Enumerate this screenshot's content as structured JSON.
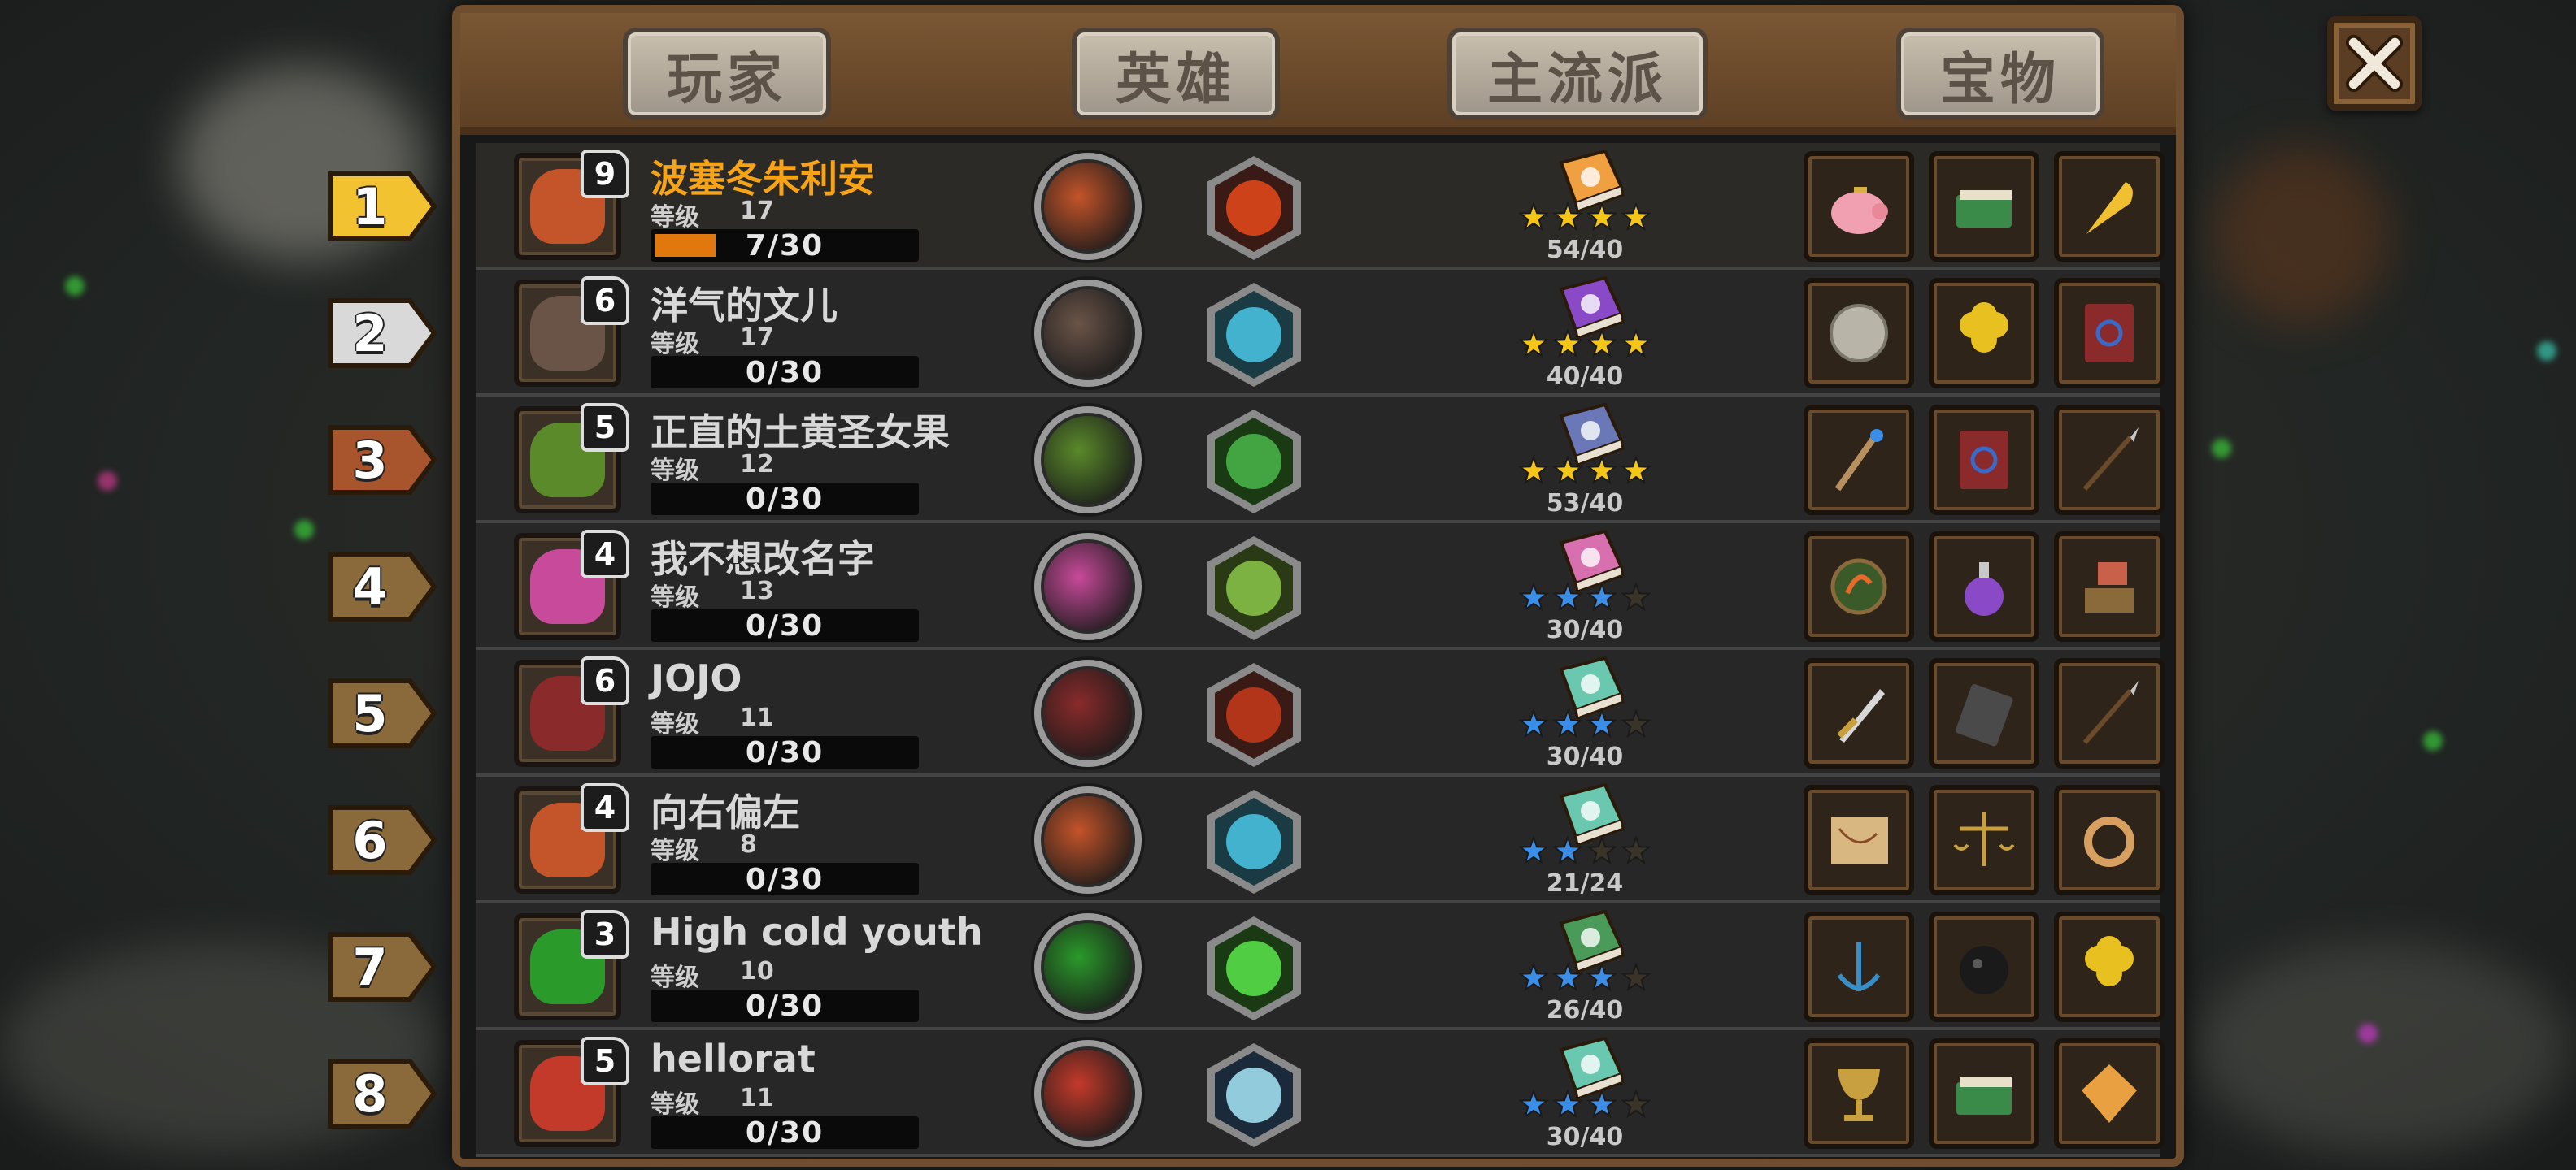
{
  "tabs": {
    "players": "玩家",
    "heroes": "英雄",
    "main_school": "主流派",
    "treasures": "宝物"
  },
  "level_label": "等级",
  "players": [
    {
      "rank": "1",
      "name": "波塞冬朱利安",
      "level": "17",
      "badge": "9",
      "xp": "7/30",
      "xp_fraction": 0.233,
      "book_count": "54/40",
      "stars": 4,
      "name_color": "#f7a318",
      "rank_color": "#f2c230",
      "hero_color": "#c4542a",
      "skill": "fire",
      "book_color": "#f0a040",
      "book_icon": "heart-icon",
      "star_color": "#f5c518",
      "treasures": [
        "piggy-bank-icon",
        "green-book-icon",
        "golden-feather-icon"
      ]
    },
    {
      "rank": "2",
      "name": "洋气的文儿",
      "level": "17",
      "badge": "6",
      "xp": "0/30",
      "xp_fraction": 0,
      "book_count": "40/40",
      "stars": 4,
      "name_color": "#d8d8d8",
      "rank_color": "#d9d9d9",
      "hero_color": "#6a5448",
      "skill": "ice",
      "book_color": "#8a4ac8",
      "book_icon": "skull-icon",
      "star_color": "#f5c518",
      "treasures": [
        "compass-coin-icon",
        "clover-icon",
        "red-spellbook-icon"
      ]
    },
    {
      "rank": "3",
      "name": "正直的土黄圣女果",
      "level": "12",
      "badge": "5",
      "xp": "0/30",
      "xp_fraction": 0,
      "book_count": "53/40",
      "stars": 4,
      "name_color": "#d8d8d8",
      "rank_color": "#a8552e",
      "hero_color": "#5a8a2a",
      "skill": "vine",
      "book_color": "#6a78b8",
      "book_icon": "sword-icon",
      "star_color": "#f5c518",
      "treasures": [
        "staff-icon",
        "red-spellbook-icon",
        "spear-icon"
      ]
    },
    {
      "rank": "4",
      "name": "我不想改名字",
      "level": "13",
      "badge": "4",
      "xp": "0/30",
      "xp_fraction": 0,
      "book_count": "30/40",
      "stars": 3,
      "name_color": "#d8d8d8",
      "rank_color": "#8a6a3a",
      "hero_color": "#c84a9a",
      "skill": "roots",
      "book_color": "#d870b0",
      "book_icon": "swirl-icon",
      "star_color": "#3a8ee8",
      "treasures": [
        "seed-medallion-icon",
        "potion-icon",
        "anvil-icon"
      ]
    },
    {
      "rank": "5",
      "name": "JOJO",
      "level": "11",
      "badge": "6",
      "xp": "0/30",
      "xp_fraction": 0,
      "book_count": "30/40",
      "stars": 3,
      "name_color": "#d8d8d8",
      "rank_color": "#8a6a3a",
      "hero_color": "#8a2a2a",
      "skill": "bomb",
      "book_color": "#6ac8b0",
      "book_icon": "sun-icon",
      "star_color": "#3a8ee8",
      "treasures": [
        "dagger-icon",
        "rune-tablet-icon",
        "spear-icon"
      ]
    },
    {
      "rank": "6",
      "name": "向右偏左",
      "level": "8",
      "badge": "4",
      "xp": "0/30",
      "xp_fraction": 0,
      "book_count": "21/24",
      "stars": 2,
      "name_color": "#d8d8d8",
      "rank_color": "#8a6a3a",
      "hero_color": "#c4542a",
      "skill": "ice",
      "book_color": "#6ac8b0",
      "book_icon": "sun-icon",
      "star_color": "#3a8ee8",
      "treasures": [
        "map-icon",
        "scales-icon",
        "ring-icon"
      ]
    },
    {
      "rank": "7",
      "name": "High cold youth",
      "level": "10",
      "badge": "3",
      "xp": "0/30",
      "xp_fraction": 0,
      "book_count": "26/40",
      "stars": 3,
      "name_color": "#d8d8d8",
      "rank_color": "#8a6a3a",
      "hero_color": "#2a9a2a",
      "skill": "wind",
      "book_color": "#4a9a5a",
      "book_icon": "skull-icon",
      "star_color": "#3a8ee8",
      "treasures": [
        "anchor-icon",
        "bomb-icon",
        "clover-icon"
      ]
    },
    {
      "rank": "8",
      "name": "hellorat",
      "level": "11",
      "badge": "5",
      "xp": "0/30",
      "xp_fraction": 0,
      "book_count": "30/40",
      "stars": 3,
      "name_color": "#d8d8d8",
      "rank_color": "#8a6a3a",
      "hero_color": "#c43a2a",
      "skill": "lightning",
      "book_color": "#6ac8b0",
      "book_icon": "sun-icon",
      "star_color": "#3a8ee8",
      "treasures": [
        "goblet-icon",
        "green-book-icon",
        "gem-icon"
      ]
    }
  ],
  "close_icon": "close-icon"
}
